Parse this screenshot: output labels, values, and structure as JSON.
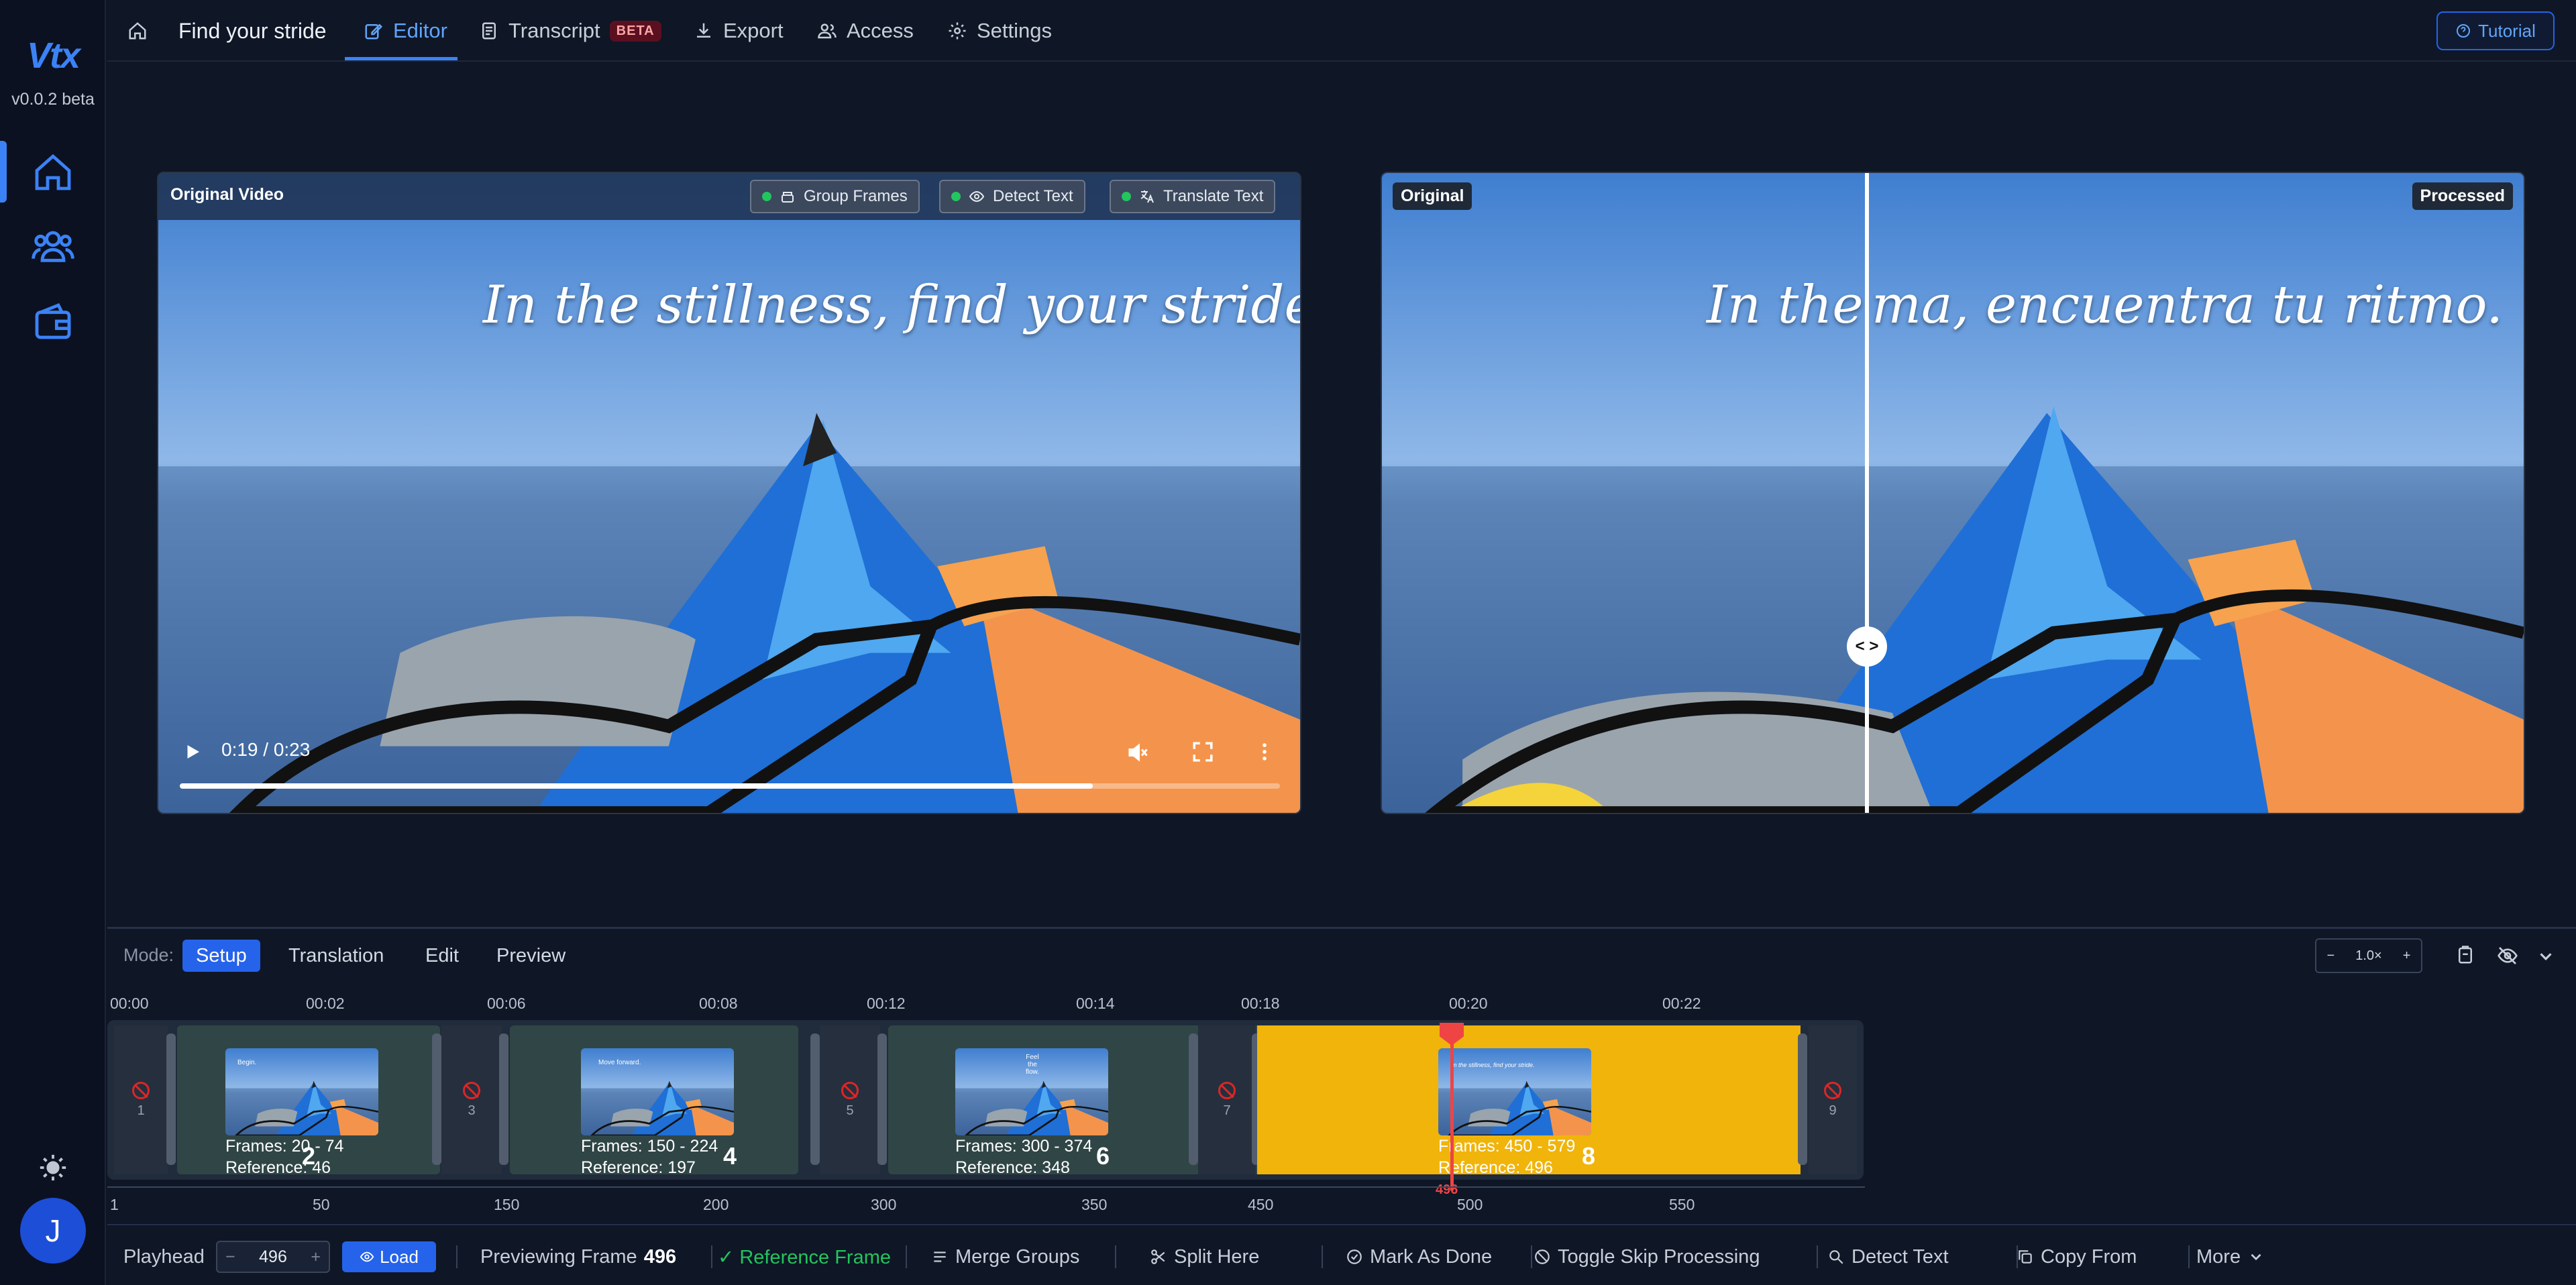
{
  "app": {
    "logo": "Vtx",
    "version": "v0.0.2 beta"
  },
  "header": {
    "title": "Find your stride",
    "tabs": [
      {
        "label": "Editor",
        "icon": "edit-icon"
      },
      {
        "label": "Transcript",
        "icon": "document-icon",
        "badge": "BETA"
      },
      {
        "label": "Export",
        "icon": "download-icon"
      },
      {
        "label": "Access",
        "icon": "users-icon"
      },
      {
        "label": "Settings",
        "icon": "gear-icon"
      }
    ],
    "tutorial_label": "Tutorial"
  },
  "sidebar": {
    "items": [
      "home-icon",
      "users-icon",
      "wallet-icon"
    ],
    "avatar": "J"
  },
  "left_panel": {
    "title": "Original Video",
    "chips": [
      "Group Frames",
      "Detect Text",
      "Translate Text"
    ],
    "caption": "In the stillness, find your stride.",
    "time": "0:19 / 0:23",
    "progress": 0.83
  },
  "right_panel": {
    "left_label": "Original",
    "right_label": "Processed",
    "caption_left": "In the ",
    "caption_right": "ma, encuentra tu ritmo.",
    "handle": "< >"
  },
  "modes": {
    "label": "Mode:",
    "items": [
      "Setup",
      "Translation",
      "Edit",
      "Preview"
    ],
    "active": "Setup"
  },
  "zoom": {
    "minus": "−",
    "value": "1.0×",
    "plus": "+"
  },
  "timeline": {
    "times": [
      "00:00",
      "00:02",
      "00:06",
      "00:08",
      "00:12",
      "00:14",
      "00:18",
      "00:20",
      "00:22"
    ],
    "gaps": [
      "1",
      "3",
      "5",
      "7",
      "9"
    ],
    "groups": [
      {
        "num": "2",
        "frames": "Frames: 20 - 74",
        "ref": "Reference: 46",
        "thumb_text": "Begin."
      },
      {
        "num": "4",
        "frames": "Frames: 150 - 224",
        "ref": "Reference: 197",
        "thumb_text": "Move forward."
      },
      {
        "num": "6",
        "frames": "Frames: 300 - 374",
        "ref": "Reference: 348",
        "thumb_text": "Feel the flow."
      },
      {
        "num": "8",
        "frames": "Frames: 450 - 579",
        "ref": "Reference: 496",
        "thumb_text": "In the stillness, find your stride."
      }
    ],
    "frame_ticks": [
      "1",
      "50",
      "150",
      "200",
      "300",
      "350",
      "450",
      "500",
      "550"
    ],
    "playhead": "496"
  },
  "status": {
    "playhead_label": "Playhead",
    "minus": "−",
    "playhead_value": "496",
    "plus": "+",
    "load_label": "Load",
    "previewing_label": "Previewing Frame",
    "previewing_value": "496",
    "reference_label": "✓ Reference Frame",
    "actions": [
      "Merge Groups",
      "Split Here",
      "Mark As Done",
      "Toggle Skip Processing",
      "Detect Text",
      "Copy From",
      "More"
    ]
  },
  "colors": {
    "accent": "#2563eb",
    "selected_group": "#f0b40b",
    "group": "#304646",
    "reference": "#22c55e",
    "playhead": "#ef4444"
  }
}
